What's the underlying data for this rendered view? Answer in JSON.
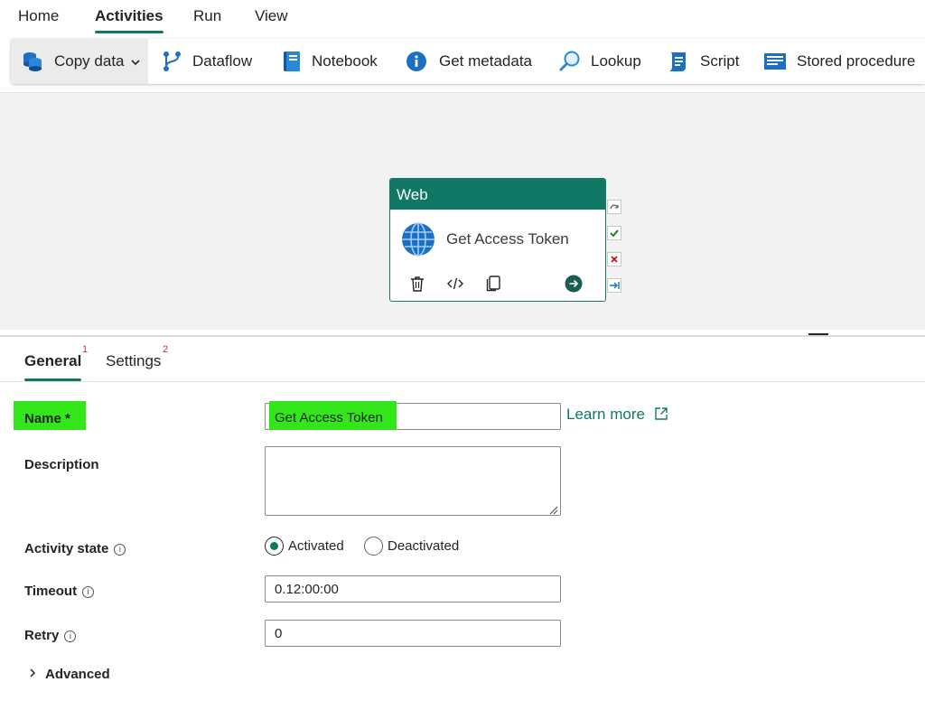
{
  "top_tabs": [
    {
      "label": "Home"
    },
    {
      "label": "Activities"
    },
    {
      "label": "Run"
    },
    {
      "label": "View"
    }
  ],
  "toolbar": {
    "items": [
      {
        "label": "Copy data",
        "icon": "copy-data-icon"
      },
      {
        "label": "Dataflow",
        "icon": "dataflow-icon"
      },
      {
        "label": "Notebook",
        "icon": "notebook-icon"
      },
      {
        "label": "Get metadata",
        "icon": "info-icon"
      },
      {
        "label": "Lookup",
        "icon": "lookup-icon"
      },
      {
        "label": "Script",
        "icon": "script-icon"
      },
      {
        "label": "Stored procedure",
        "icon": "stored-procedure-icon"
      }
    ]
  },
  "activity_card": {
    "type": "Web",
    "name": "Get Access Token"
  },
  "panel_tabs": [
    {
      "label": "General",
      "badge": "1"
    },
    {
      "label": "Settings",
      "badge": "2"
    }
  ],
  "form": {
    "name_label": "Name *",
    "name_value": "Get Access Token",
    "learn_more": "Learn more",
    "description_label": "Description",
    "description_value": "",
    "activity_state_label": "Activity state",
    "activated_label": "Activated",
    "deactivated_label": "Deactivated",
    "timeout_label": "Timeout",
    "timeout_value": "0.12:00:00",
    "retry_label": "Retry",
    "retry_value": "0",
    "advanced_label": "Advanced"
  },
  "colors": {
    "accent": "#117865",
    "highlight": "#33e61a",
    "badge": "#c4314b"
  }
}
